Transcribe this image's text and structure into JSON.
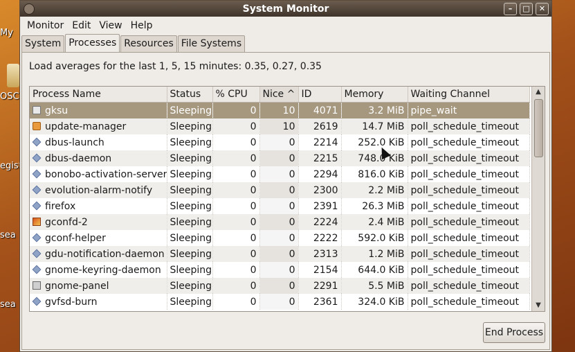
{
  "desktop": {
    "labels": [
      "My",
      "OSC",
      "egist",
      "sea",
      "sea"
    ]
  },
  "window": {
    "title": "System Monitor",
    "buttons": {
      "minimize": "–",
      "maximize": "□",
      "close": "✕"
    }
  },
  "menubar": [
    "Monitor",
    "Edit",
    "View",
    "Help"
  ],
  "tabs": [
    "System",
    "Processes",
    "Resources",
    "File Systems"
  ],
  "active_tab": "Processes",
  "load_text": "Load averages for the last 1, 5, 15 minutes: 0.35, 0.27, 0.35",
  "table": {
    "columns": [
      "Process Name",
      "Status",
      "% CPU",
      "Nice ^",
      "ID",
      "Memory",
      "Waiting Channel"
    ],
    "rows": [
      {
        "icon": "gksu-icon",
        "name": "gksu",
        "status": "Sleeping",
        "cpu": "0",
        "nice": "10",
        "id": "4071",
        "memory": "3.2 MiB",
        "channel": "pipe_wait"
      },
      {
        "icon": "update-manager-icon",
        "name": "update-manager",
        "status": "Sleeping",
        "cpu": "0",
        "nice": "10",
        "id": "2619",
        "memory": "14.7 MiB",
        "channel": "poll_schedule_timeout"
      },
      {
        "icon": "process-icon",
        "name": "dbus-launch",
        "status": "Sleeping",
        "cpu": "0",
        "nice": "0",
        "id": "2214",
        "memory": "252.0 KiB",
        "channel": "poll_schedule_timeout"
      },
      {
        "icon": "process-icon",
        "name": "dbus-daemon",
        "status": "Sleeping",
        "cpu": "0",
        "nice": "0",
        "id": "2215",
        "memory": "748.0 KiB",
        "channel": "poll_schedule_timeout"
      },
      {
        "icon": "process-icon",
        "name": "bonobo-activation-server",
        "status": "Sleeping",
        "cpu": "0",
        "nice": "0",
        "id": "2294",
        "memory": "816.0 KiB",
        "channel": "poll_schedule_timeout"
      },
      {
        "icon": "process-icon",
        "name": "evolution-alarm-notify",
        "status": "Sleeping",
        "cpu": "0",
        "nice": "0",
        "id": "2300",
        "memory": "2.2 MiB",
        "channel": "poll_schedule_timeout"
      },
      {
        "icon": "process-icon",
        "name": "firefox",
        "status": "Sleeping",
        "cpu": "0",
        "nice": "0",
        "id": "2391",
        "memory": "26.3 MiB",
        "channel": "poll_schedule_timeout"
      },
      {
        "icon": "gconfd-icon",
        "name": "gconfd-2",
        "status": "Sleeping",
        "cpu": "0",
        "nice": "0",
        "id": "2224",
        "memory": "2.4 MiB",
        "channel": "poll_schedule_timeout"
      },
      {
        "icon": "process-icon",
        "name": "gconf-helper",
        "status": "Sleeping",
        "cpu": "0",
        "nice": "0",
        "id": "2222",
        "memory": "592.0 KiB",
        "channel": "poll_schedule_timeout"
      },
      {
        "icon": "process-icon",
        "name": "gdu-notification-daemon",
        "status": "Sleeping",
        "cpu": "0",
        "nice": "0",
        "id": "2313",
        "memory": "1.2 MiB",
        "channel": "poll_schedule_timeout"
      },
      {
        "icon": "process-icon",
        "name": "gnome-keyring-daemon",
        "status": "Sleeping",
        "cpu": "0",
        "nice": "0",
        "id": "2154",
        "memory": "644.0 KiB",
        "channel": "poll_schedule_timeout"
      },
      {
        "icon": "panel-icon",
        "name": "gnome-panel",
        "status": "Sleeping",
        "cpu": "0",
        "nice": "0",
        "id": "2291",
        "memory": "5.5 MiB",
        "channel": "poll_schedule_timeout"
      },
      {
        "icon": "process-icon",
        "name": "gvfsd-burn",
        "status": "Sleeping",
        "cpu": "0",
        "nice": "0",
        "id": "2361",
        "memory": "324.0 KiB",
        "channel": "poll_schedule_timeout"
      }
    ]
  },
  "end_process_label": "End Process",
  "colors": {
    "selection": "#a6977f",
    "titlebar": "#3f342b"
  }
}
